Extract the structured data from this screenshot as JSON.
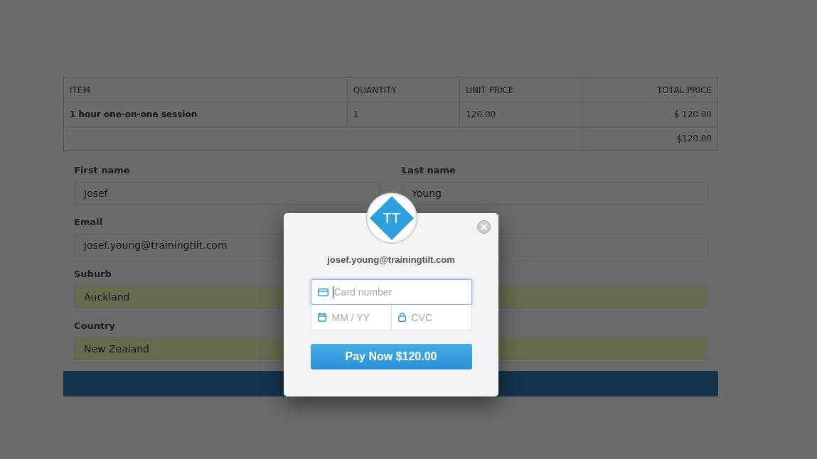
{
  "table": {
    "columns": [
      {
        "label": "ITEM"
      },
      {
        "label": "QUANTITY"
      },
      {
        "label": "UNIT PRICE"
      },
      {
        "label": "TOTAL PRICE"
      }
    ],
    "rows": [
      {
        "item": "1 hour one-on-one session",
        "quantity": "1",
        "unit_price": "120.00",
        "total_price": "$ 120.00"
      }
    ],
    "total": "$120.00"
  },
  "form": {
    "rows": [
      [
        {
          "label": "First name",
          "value": "Josef",
          "autofilled": false
        },
        {
          "label": "Last name",
          "value": "Young",
          "autofilled": false
        }
      ],
      [
        {
          "label": "Email",
          "value": "josef.young@trainingtilt.com",
          "autofilled": false
        },
        {
          "autofilled": false
        }
      ],
      [
        {
          "label": "Suburb",
          "value": "Auckland",
          "autofilled": true
        },
        {
          "autofilled": true
        }
      ],
      [
        {
          "label": "Country",
          "value": "New Zealand",
          "autofilled": true
        },
        {
          "autofilled": true
        }
      ]
    ]
  },
  "payment_dialog": {
    "logo_text": "TT",
    "email": "josef.young@trainingtilt.com",
    "card_number": {
      "placeholder": "Card number",
      "focused": true
    },
    "expiry": {
      "placeholder": "MM / YY"
    },
    "cvc": {
      "placeholder": "CVC"
    },
    "pay_button": "Pay Now $120.00"
  }
}
